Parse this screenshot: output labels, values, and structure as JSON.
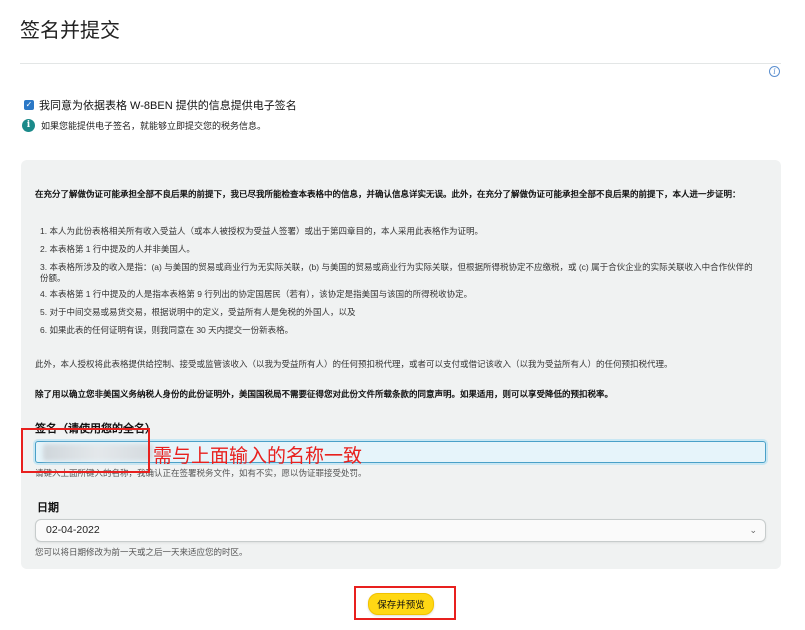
{
  "page": {
    "title": "签名并提交"
  },
  "consent": {
    "label": "我同意为依据表格 W-8BEN 提供的信息提供电子签名",
    "checked": true,
    "note": "如果您能提供电子签名，就能够立即提交您的税务信息。"
  },
  "certification": {
    "intro": "在充分了解做伪证可能承担全部不良后果的前提下，我已尽我所能检查本表格中的信息，并确认信息详实无误。此外，在充分了解做伪证可能承担全部不良后果的前提下，本人进一步证明：",
    "items": [
      "1. 本人为此份表格相关所有收入受益人（或本人被授权为受益人签署）或出于第四章目的，本人采用此表格作为证明。",
      "2. 本表格第 1 行中提及的人并非美国人。",
      "3. 本表格所涉及的收入是指：(a) 与美国的贸易或商业行为无实际关联，(b) 与美国的贸易或商业行为实际关联，但根据所得税协定不应缴税，或 (c) 属于合伙企业的实际关联收入中合作伙伴的份额。",
      "4. 本表格第 1 行中提及的人是指本表格第 9 行列出的协定国居民（若有），该协定是指美国与该国的所得税收协定。",
      "5. 对于中间交易或易货交易，根据说明中的定义，受益所有人是免税的外国人，以及",
      "6. 如果此表的任何证明有误，则我同意在 30 天内提交一份新表格。"
    ],
    "authorization": "此外，本人授权将此表格提供给控制、接受或监管该收入（以我为受益所有人）的任何预扣税代理，或者可以支付或借记该收入（以我为受益所有人）的任何预扣税代理。",
    "irs_note": "除了用以确立您非美国义务纳税人身份的此份证明外，美国国税局不需要征得您对此份文件所载条款的同意声明。如果适用，则可以享受降低的预扣税率。"
  },
  "signature": {
    "label": "签名（请使用您的全名）",
    "value": "",
    "help": "请键入上面所键入的名称，我确认正在签署税务文件，如有不实，愿以伪证罪接受处罚。"
  },
  "date": {
    "label": "日期",
    "value": "02-04-2022",
    "help": "您可以将日期修改为前一天或之后一天来适应您的时区。"
  },
  "submit": {
    "label": "保存并预览"
  },
  "annotation": {
    "text": "需与上面输入的名称一致",
    "color": "#e8201e"
  },
  "icons": {
    "info_top": "info-icon",
    "note": "info-circle-icon",
    "chevron": "chevron-down-icon",
    "checkbox": "check-icon"
  }
}
